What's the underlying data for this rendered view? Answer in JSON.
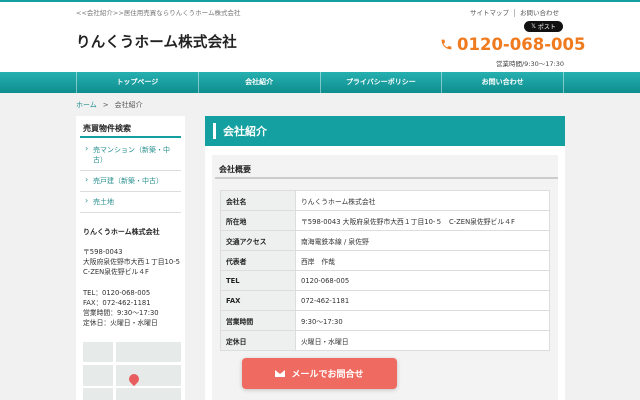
{
  "header": {
    "tagline": "<<会社紹介>>居住用売買ならりんくうホーム株式会社",
    "links": [
      "サイトマップ",
      "お問い合わせ"
    ],
    "x_post": "ポスト",
    "logo": "りんくうホーム株式会社",
    "phone": "0120-068-005",
    "hours": "営業時間/9:30〜17:30"
  },
  "nav": {
    "items": [
      "トップページ",
      "会社紹介",
      "プライバシーポリシー",
      "お問い合わせ"
    ]
  },
  "breadcrumb": {
    "home": "ホーム",
    "sep": ">",
    "current": "会社紹介"
  },
  "sidebar": {
    "title": "売買物件検索",
    "links": [
      "売マンション（新築・中古）",
      "売戸建（新築・中古）",
      "売土地"
    ],
    "company": "りんくうホーム株式会社",
    "postal": "〒598-0043",
    "address": "大阪府泉佐野市大西１丁目10-5　C-ZEN泉佐野ビル４F",
    "tel": "TEL：0120-068-005",
    "fax": "FAX：072-462-1181",
    "hours": "営業時間：9:30〜17:30",
    "closed": "定休日：火曜日・水曜日"
  },
  "main": {
    "title": "会社紹介",
    "section_title": "会社概要",
    "rows": [
      {
        "label": "会社名",
        "value": "りんくうホーム株式会社"
      },
      {
        "label": "所在地",
        "value": "〒598-0043 大阪府泉佐野市大西１丁目10-５　C-ZEN泉佐野ビル４F"
      },
      {
        "label": "交通アクセス",
        "value": "南海電鉄本線 / 泉佐野"
      },
      {
        "label": "代表者",
        "value": "西岸　作哉"
      },
      {
        "label": "TEL",
        "value": "0120-068-005"
      },
      {
        "label": "FAX",
        "value": "072-462-1181"
      },
      {
        "label": "営業時間",
        "value": "9:30〜17:30"
      },
      {
        "label": "定休日",
        "value": "火曜日・水曜日"
      }
    ]
  },
  "cta": {
    "label": "メールでお問合せ"
  },
  "colors": {
    "teal": "#14a0a0",
    "orange": "#f07a1e",
    "cta": "#ef6a60"
  }
}
